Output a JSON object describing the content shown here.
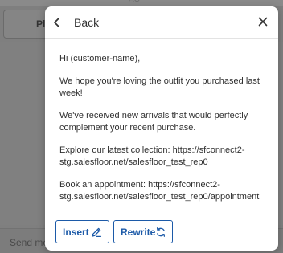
{
  "background": {
    "top_label": "AC",
    "partial_button_label": "Pl",
    "compose_placeholder": "Send me"
  },
  "dialog": {
    "back_label": "Back",
    "close_icon": "close-icon",
    "back_icon": "chevron-left-icon",
    "message": {
      "greeting": "Hi (customer-name),",
      "paragraph1": "We hope you're loving the outfit you purchased last week!",
      "paragraph2": "We've received new arrivals that would perfectly complement your recent purchase.",
      "paragraph3": "Explore our latest collection: https://sfconnect2-stg.salesfloor.net/salesfloor_test_rep0",
      "paragraph4": "Book an appointment: https://sfconnect2-stg.salesfloor.net/salesfloor_test_rep0/appointment"
    },
    "actions": {
      "insert_label": "Insert",
      "insert_icon": "pencil-icon",
      "rewrite_label": "Rewrite",
      "rewrite_icon": "refresh-icon"
    }
  },
  "colors": {
    "accent": "#1c5aa8",
    "overlay": "#7f7f7f",
    "text": "#2f2f2f"
  }
}
